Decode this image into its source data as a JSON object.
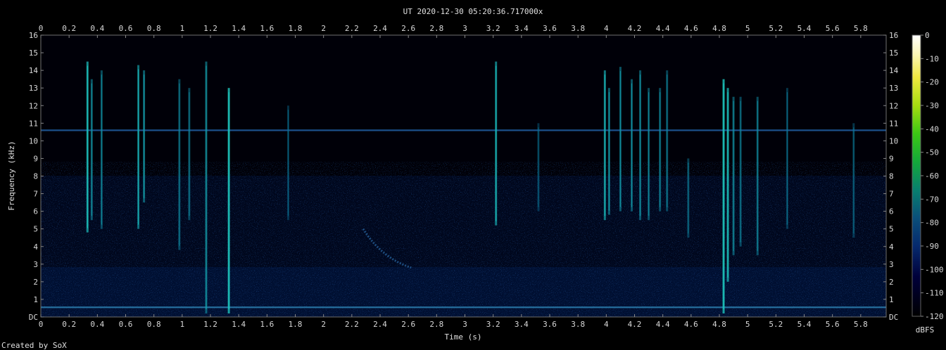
{
  "chart_data": {
    "type": "heatmap",
    "title": "UT 2020-12-30 05:20:36.717000x",
    "xlabel": "Time (s)",
    "ylabel": "Frequency (kHz)",
    "xlim": [
      0,
      5.98
    ],
    "ylim": [
      0,
      16
    ],
    "x_ticks": [
      "0",
      "0.2",
      "0.4",
      "0.6",
      "0.8",
      "1",
      "1.2",
      "1.4",
      "1.6",
      "1.8",
      "2",
      "2.2",
      "2.4",
      "2.6",
      "2.8",
      "3",
      "3.2",
      "3.4",
      "3.6",
      "3.8",
      "4",
      "4.2",
      "4.4",
      "4.6",
      "4.8",
      "5",
      "5.2",
      "5.4",
      "5.6",
      "5.8"
    ],
    "y_ticks": [
      "DC",
      "1",
      "2",
      "3",
      "4",
      "5",
      "6",
      "7",
      "8",
      "9",
      "10",
      "11",
      "12",
      "13",
      "14",
      "15",
      "16"
    ],
    "colorbar": {
      "label": "dBFS",
      "ticks": [
        "0",
        "-10",
        "-20",
        "-30",
        "-40",
        "-50",
        "-60",
        "-70",
        "-80",
        "-90",
        "-100",
        "-110",
        "-120"
      ],
      "range": [
        -120,
        0
      ]
    },
    "credit": "Created by SoX",
    "features": {
      "tone_lines_khz": [
        10.6,
        0.55
      ],
      "impulses": [
        {
          "t": 0.33,
          "f_low": 4.8,
          "f_high": 14.5,
          "level": 0.85
        },
        {
          "t": 0.36,
          "f_low": 5.5,
          "f_high": 13.5,
          "level": 0.55
        },
        {
          "t": 0.43,
          "f_low": 5.0,
          "f_high": 14.0,
          "level": 0.5
        },
        {
          "t": 0.69,
          "f_low": 5.0,
          "f_high": 14.3,
          "level": 0.7
        },
        {
          "t": 0.73,
          "f_low": 6.5,
          "f_high": 14.0,
          "level": 0.6
        },
        {
          "t": 0.98,
          "f_low": 3.8,
          "f_high": 13.5,
          "level": 0.45
        },
        {
          "t": 1.05,
          "f_low": 5.5,
          "f_high": 13.0,
          "level": 0.45
        },
        {
          "t": 1.17,
          "f_low": 0.2,
          "f_high": 14.5,
          "level": 0.6
        },
        {
          "t": 1.33,
          "f_low": 0.2,
          "f_high": 13.0,
          "level": 0.95
        },
        {
          "t": 1.75,
          "f_low": 5.5,
          "f_high": 12.0,
          "level": 0.3
        },
        {
          "t": 3.22,
          "f_low": 5.2,
          "f_high": 14.5,
          "level": 0.75
        },
        {
          "t": 3.52,
          "f_low": 6.0,
          "f_high": 11.0,
          "level": 0.3
        },
        {
          "t": 3.99,
          "f_low": 5.5,
          "f_high": 14.0,
          "level": 0.75
        },
        {
          "t": 4.02,
          "f_low": 5.8,
          "f_high": 13.0,
          "level": 0.6
        },
        {
          "t": 4.1,
          "f_low": 6.0,
          "f_high": 14.2,
          "level": 0.55
        },
        {
          "t": 4.18,
          "f_low": 6.0,
          "f_high": 13.5,
          "level": 0.55
        },
        {
          "t": 4.24,
          "f_low": 5.5,
          "f_high": 14.0,
          "level": 0.55
        },
        {
          "t": 4.3,
          "f_low": 5.5,
          "f_high": 13.0,
          "level": 0.5
        },
        {
          "t": 4.38,
          "f_low": 6.0,
          "f_high": 13.0,
          "level": 0.5
        },
        {
          "t": 4.43,
          "f_low": 6.0,
          "f_high": 14.0,
          "level": 0.45
        },
        {
          "t": 4.58,
          "f_low": 4.5,
          "f_high": 9.0,
          "level": 0.4
        },
        {
          "t": 4.83,
          "f_low": 0.2,
          "f_high": 13.5,
          "level": 0.95
        },
        {
          "t": 4.86,
          "f_low": 2.0,
          "f_high": 13.0,
          "level": 0.85
        },
        {
          "t": 4.9,
          "f_low": 3.5,
          "f_high": 12.5,
          "level": 0.55
        },
        {
          "t": 4.95,
          "f_low": 4.0,
          "f_high": 12.5,
          "level": 0.45
        },
        {
          "t": 5.07,
          "f_low": 3.5,
          "f_high": 12.5,
          "level": 0.5
        },
        {
          "t": 5.28,
          "f_low": 5.0,
          "f_high": 13.0,
          "level": 0.35
        },
        {
          "t": 5.75,
          "f_low": 4.5,
          "f_high": 11.0,
          "level": 0.35
        }
      ],
      "whistler": {
        "t_start": 2.28,
        "f_start": 5.0,
        "t_end": 2.62,
        "f_end": 2.8,
        "level": 0.35
      }
    }
  }
}
